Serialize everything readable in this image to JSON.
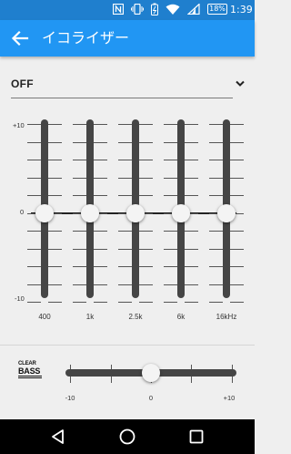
{
  "status_bar": {
    "battery": "18%",
    "time": "1:39",
    "icons": [
      "nfc-icon",
      "vibrate-icon",
      "stamina-icon",
      "wifi-icon",
      "signal-icon",
      "battery-icon"
    ]
  },
  "app_bar": {
    "title": "イコライザー",
    "back_icon": "arrow-back-icon",
    "color": "#2196f3"
  },
  "preset": {
    "value": "OFF",
    "arrow_icon": "chevron-down-icon"
  },
  "equalizer": {
    "scale_max": "+10",
    "scale_zero": "0",
    "scale_min": "-10",
    "range": [
      -10,
      10
    ],
    "bands": [
      {
        "label": "400",
        "value": 0
      },
      {
        "label": "1k",
        "value": 0
      },
      {
        "label": "2.5k",
        "value": 0
      },
      {
        "label": "6k",
        "value": 0
      },
      {
        "label": "16kHz",
        "value": 0
      }
    ]
  },
  "clear_bass": {
    "logo_line1": "CLEAR",
    "logo_line2": "BASS",
    "min_label": "-10",
    "mid_label": "0",
    "max_label": "+10",
    "range": [
      -10,
      10
    ],
    "value": 0
  },
  "nav_bar": {
    "icons": [
      "back-triangle-icon",
      "home-circle-icon",
      "recents-square-icon"
    ]
  }
}
